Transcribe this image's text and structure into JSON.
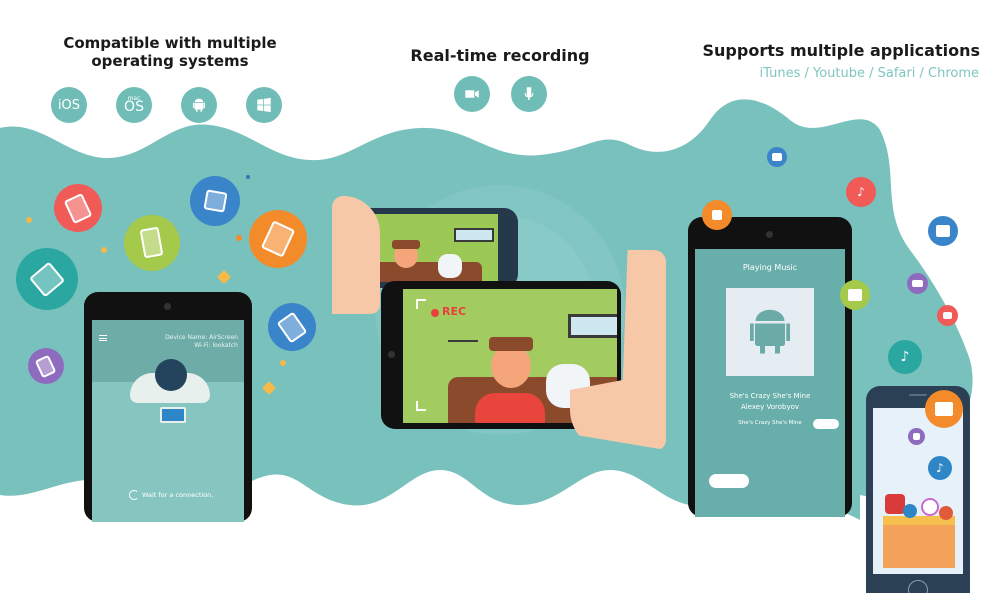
{
  "features": {
    "compatibility": {
      "title_line1": "Compatible with multiple",
      "title_line2": "operating systems",
      "icons": [
        {
          "name": "ios-icon",
          "label": "iOS"
        },
        {
          "name": "macos-icon",
          "label_small": "mac",
          "label": "OS"
        },
        {
          "name": "android-icon",
          "label": ""
        },
        {
          "name": "windows-icon",
          "label": ""
        }
      ]
    },
    "recording": {
      "title": "Real-time recording",
      "icons": [
        {
          "name": "video-camera-icon"
        },
        {
          "name": "microphone-icon"
        }
      ]
    },
    "applications": {
      "title": "Supports multiple applications",
      "subtitle": "iTunes / Youtube / Safari / Chrome"
    }
  },
  "left_phone": {
    "menu_icon": "hamburger-menu-icon",
    "device_name": "Device Name: AirScreen",
    "wifi": "Wi-Fi: lookatch",
    "status": "Wait for a connection."
  },
  "center_phone": {
    "rec_label": "REC"
  },
  "right_phone": {
    "title": "Playing Music",
    "song": "She's Crazy She's Mine",
    "artist": "Alexey Vorobyov",
    "lyric": "She's Crazy She's Mine"
  },
  "colors": {
    "teal_bg": "#78c1bd",
    "icon_teal": "#6fbdb6",
    "subtitle": "#7fc6c0",
    "rec_red": "#e8403a"
  }
}
